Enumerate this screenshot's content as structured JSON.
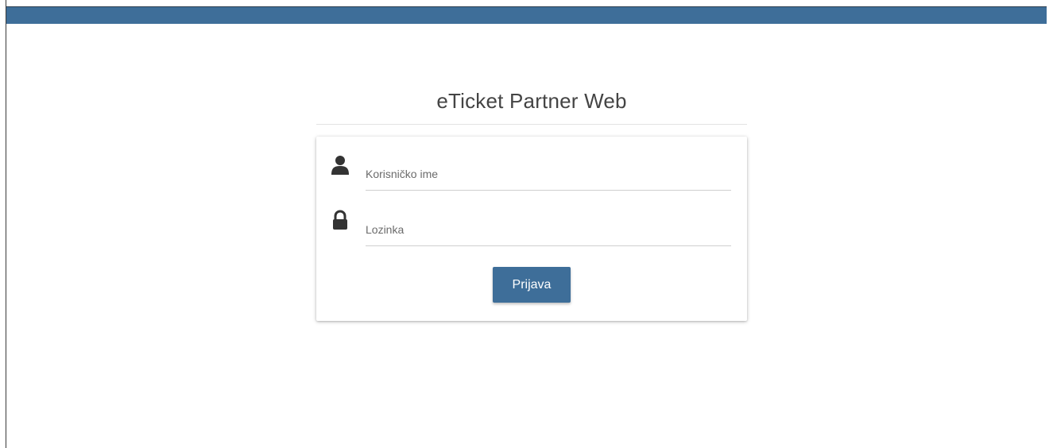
{
  "app": {
    "title": "eTicket Partner Web",
    "accent_color": "#3e6e99"
  },
  "login_form": {
    "username": {
      "icon": "user-icon",
      "placeholder": "Korisničko ime",
      "value": ""
    },
    "password": {
      "icon": "lock-icon",
      "placeholder": "Lozinka",
      "value": ""
    },
    "submit_label": "Prijava"
  }
}
